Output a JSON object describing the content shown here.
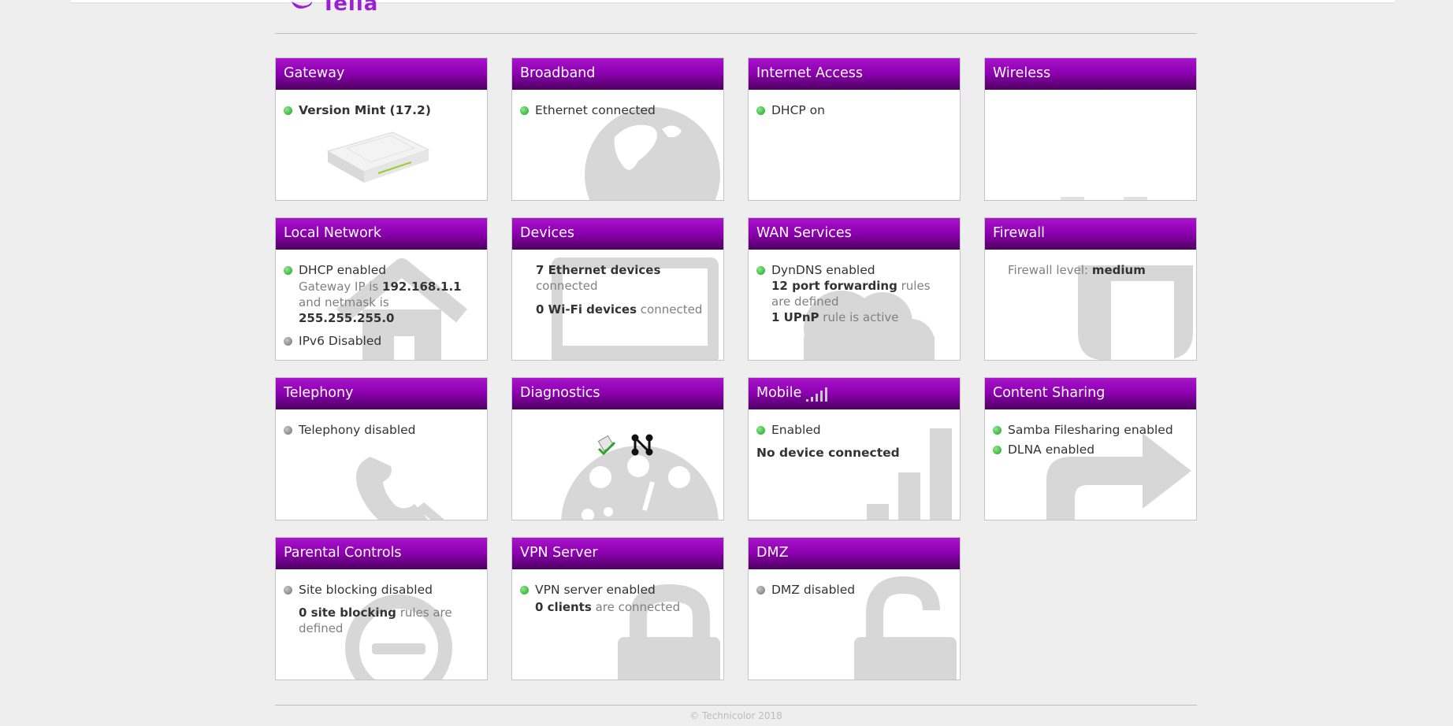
{
  "brand": {
    "name": "Telia",
    "accent": "#9b1fd6"
  },
  "footer": {
    "copyright": "© Technicolor 2018"
  },
  "cards": {
    "gateway": {
      "title": "Gateway",
      "version": "Version Mint (17.2)"
    },
    "broadband": {
      "title": "Broadband",
      "status": "Ethernet connected"
    },
    "internet": {
      "title": "Internet Access",
      "status": "DHCP on"
    },
    "wireless": {
      "title": "Wireless"
    },
    "local": {
      "title": "Local Network",
      "dhcp": "DHCP enabled",
      "gw_prefix": "Gateway IP is",
      "gw_ip": "192.168.1.1",
      "mask_prefix": "and netmask is",
      "mask": "255.255.255.0",
      "ipv6": "IPv6 Disabled"
    },
    "devices": {
      "title": "Devices",
      "eth_count": "7 Ethernet devices",
      "eth_suffix": "connected",
      "wifi_count": "0 Wi-Fi devices",
      "wifi_suffix": "connected"
    },
    "wan": {
      "title": "WAN Services",
      "dyndns": "DynDNS enabled",
      "pf_bold": "12 port forwarding",
      "pf_rest": "rules are defined",
      "upnp_bold": "1 UPnP",
      "upnp_rest": "rule is active"
    },
    "firewall": {
      "title": "Firewall",
      "label": "Firewall level:",
      "level": "medium"
    },
    "telephony": {
      "title": "Telephony",
      "status": "Telephony disabled"
    },
    "diagnostics": {
      "title": "Diagnostics"
    },
    "mobile": {
      "title": "Mobile",
      "status": "Enabled",
      "device": "No device connected",
      "signal_icon": "signal-bars-icon"
    },
    "sharing": {
      "title": "Content Sharing",
      "samba": "Samba Filesharing enabled",
      "dlna": "DLNA enabled"
    },
    "parental": {
      "title": "Parental Controls",
      "status": "Site blocking disabled",
      "rules_bold": "0 site blocking",
      "rules_rest": "rules are defined"
    },
    "vpn": {
      "title": "VPN Server",
      "status": "VPN server enabled",
      "clients_bold": "0 clients",
      "clients_rest": "are connected"
    },
    "dmz": {
      "title": "DMZ",
      "status": "DMZ disabled"
    }
  }
}
